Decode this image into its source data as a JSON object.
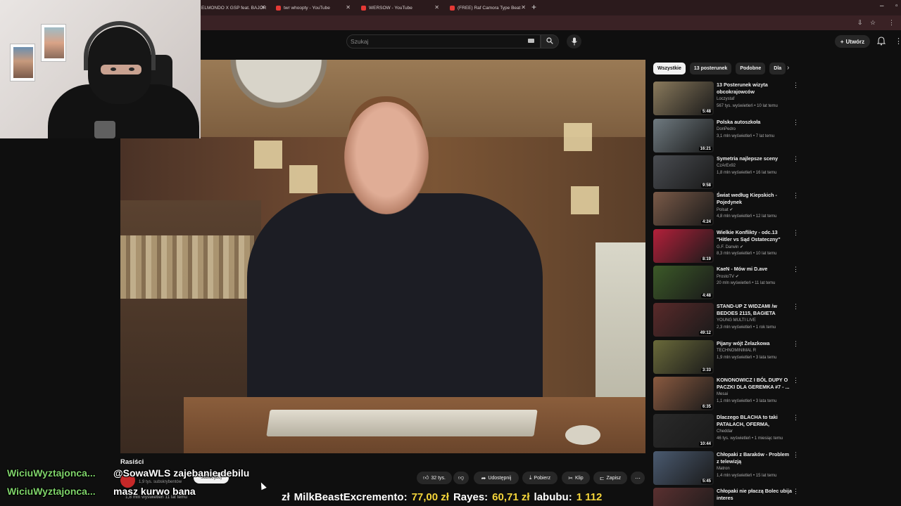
{
  "tabs": [
    {
      "label": "ELMONDO X GSP feat. BAJOR"
    },
    {
      "label": "twr whoopty - YouTube"
    },
    {
      "label": "WERSOW - YouTube"
    },
    {
      "label": "(FREE) Raf Camora Type Beat -"
    }
  ],
  "header": {
    "search_placeholder": "Szukaj",
    "create_label": "Utwórz"
  },
  "video": {
    "channel": "Rasiści",
    "subscribers": "1,9 tys. subskrybentów",
    "subscribe_label": "Subskrybuj",
    "meta": "1,8 mln wyświetleń  11 lat temu",
    "actions": {
      "likes": "32 tys.",
      "share": "Udostępnij",
      "download": "Pobierz",
      "clip": "Klip",
      "save": "Zapisz"
    }
  },
  "chat": [
    {
      "user": "WiciuWyztajonca...",
      "message": "@SowaWLS zajebanie debilu"
    },
    {
      "user": "WiciuWyztajonca...",
      "message": "masz kurwo bana"
    }
  ],
  "ticker": [
    {
      "prefix": "zł",
      "name": "MilkBeastExcremento:",
      "amount": "77,00 zł"
    },
    {
      "prefix": "",
      "name": "Rayes:",
      "amount": "60,71 zł"
    },
    {
      "prefix": "",
      "name": "labubu:",
      "amount": "1 112"
    }
  ],
  "chips": [
    "Wszystkie",
    "13 posterunek",
    "Podobne",
    "Dla"
  ],
  "recommendations": [
    {
      "title": "13 Posterunek  wizyta obcokrajowców",
      "channel": "Loczystaf",
      "meta": "567 tys. wyświetleń • 10 lat temu",
      "duration": "5:48",
      "color": "#8a7a5c"
    },
    {
      "title": "Polska autoszkoła",
      "channel": "DonPedro",
      "meta": "3,1 mln wyświetleń • 7 lat temu",
      "duration": "16:21",
      "color": "#6f7a80"
    },
    {
      "title": "Symetria najlepsze sceny",
      "channel": "CzArEx92",
      "meta": "1,8 mln wyświetleń • 16 lat temu",
      "duration": "9:58",
      "color": "#4a4d52"
    },
    {
      "title": "Świat według Kiepskich - Pojedynek",
      "channel": "Polsat",
      "meta": "4,8 mln wyświetleń • 12 lat temu",
      "duration": "4:24",
      "color": "#7a5a48"
    },
    {
      "title": "Wielkie Konflikty - odc.13 \"Hitler vs Sąd Ostateczny\"",
      "channel": "G.F. Darwin",
      "meta": "8,3 mln wyświetleń • 10 lat temu",
      "duration": "8:19",
      "color": "#b3203a"
    },
    {
      "title": "KaeN - Mów mi D.ave",
      "channel": "ProstoTV",
      "meta": "20 mln wyświetleń • 11 lat temu",
      "duration": "4:48",
      "color": "#3c5a28"
    },
    {
      "title": "STAND-UP Z WIDZAMI /w BEDOES 2115, BAGIETA",
      "channel": "YOUNG MULTI LIVE",
      "meta": "2,3 mln wyświetleń • 1 rok temu",
      "duration": "49:12",
      "color": "#5a2a2a"
    },
    {
      "title": "Pijany wójt Żelazkowa",
      "channel": "TECHNOMINIMAL R",
      "meta": "1,9 mln wyświetleń • 3 lata temu",
      "duration": "3:33",
      "color": "#6a6a3a"
    },
    {
      "title": "KONONOWICZ I BÓL DUPY O PACZKI DLA GEREMKA #7 - ...",
      "channel": "Mesai",
      "meta": "1,1 mln wyświetleń • 3 lata temu",
      "duration": "6:35",
      "color": "#8a5a40"
    },
    {
      "title": "Dlaczego BLACHA to taki PATAŁACH, OFERMA, GAMOŃ...",
      "channel": "Cheddar",
      "meta": "46 tys. wyświetleń • 1 miesiąc temu",
      "duration": "10:44",
      "color": "#2a2a2a"
    },
    {
      "title": "Chłopaki z Baraków - Problem z telewizją",
      "channel": "Matron",
      "meta": "1,4 mln wyświetleń • 15 lat temu",
      "duration": "5:45",
      "color": "#4a5a70"
    },
    {
      "title": "Chłopaki nie płaczą Bolec ubija interes",
      "channel": "",
      "meta": "",
      "duration": "",
      "color": "#5a3030"
    }
  ]
}
